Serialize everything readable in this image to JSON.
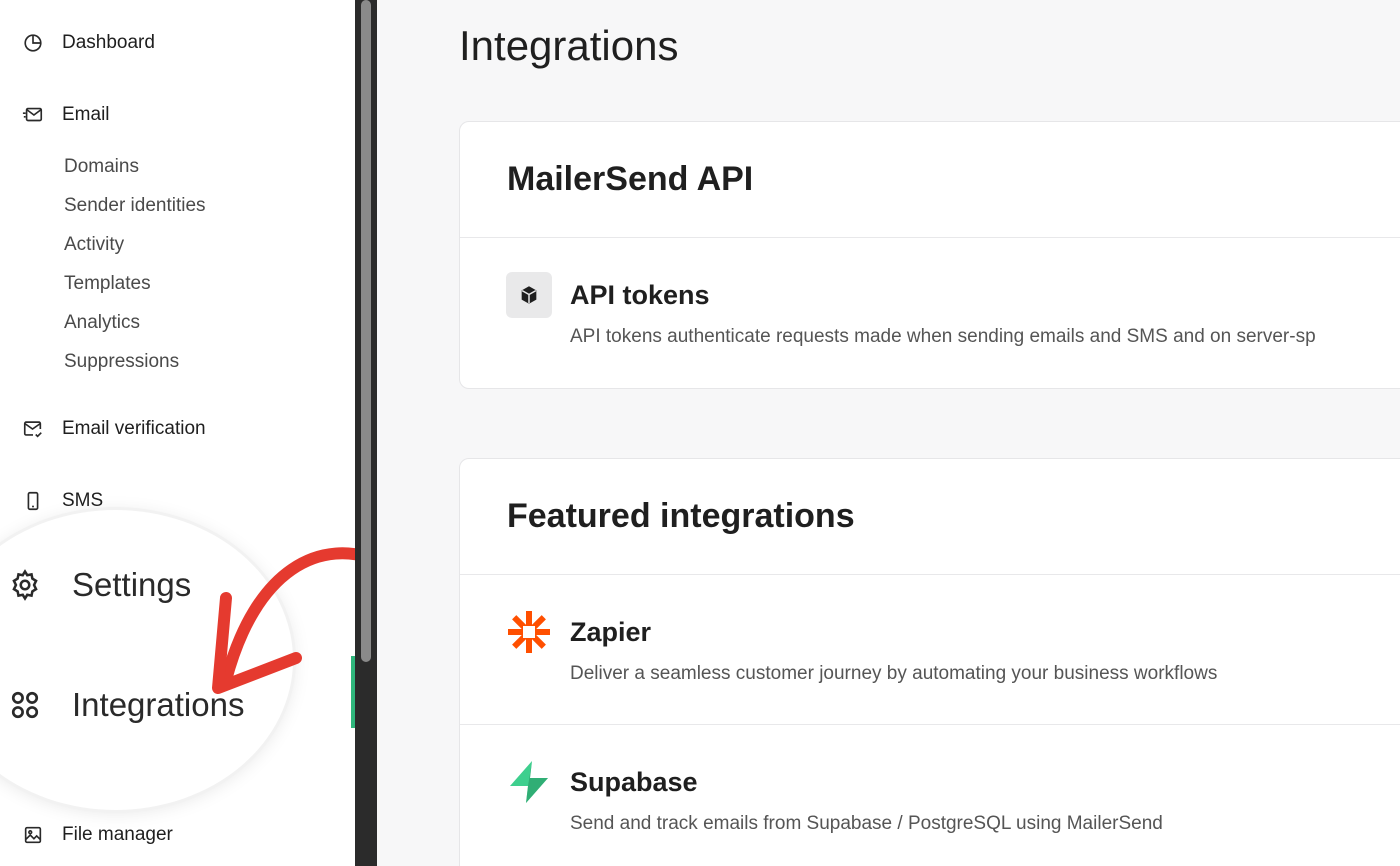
{
  "sidebar": {
    "dashboard": "Dashboard",
    "email": "Email",
    "email_subitems": [
      "Domains",
      "Sender identities",
      "Activity",
      "Templates",
      "Analytics",
      "Suppressions"
    ],
    "email_verification": "Email verification",
    "sms": "SMS",
    "file_manager": "File manager",
    "magnified": {
      "settings": "Settings",
      "integrations": "Integrations"
    },
    "active_color": "#2fb67c"
  },
  "main": {
    "page_title": "Integrations",
    "api_section": {
      "title": "MailerSend API",
      "items": [
        {
          "name": "API tokens",
          "description": "API tokens authenticate requests made when sending emails and SMS and on server-sp",
          "icon": "cube-icon"
        }
      ]
    },
    "featured_section": {
      "title": "Featured integrations",
      "items": [
        {
          "name": "Zapier",
          "description": "Deliver a seamless customer journey by automating your business workflows",
          "icon": "zapier-logo",
          "color": "#ff4f00"
        },
        {
          "name": "Supabase",
          "description": "Send and track emails from Supabase / PostgreSQL using MailerSend",
          "icon": "supabase-logo",
          "color": "#3ecf8e"
        }
      ]
    }
  },
  "annotation": {
    "arrow_color": "#e53a2f"
  }
}
